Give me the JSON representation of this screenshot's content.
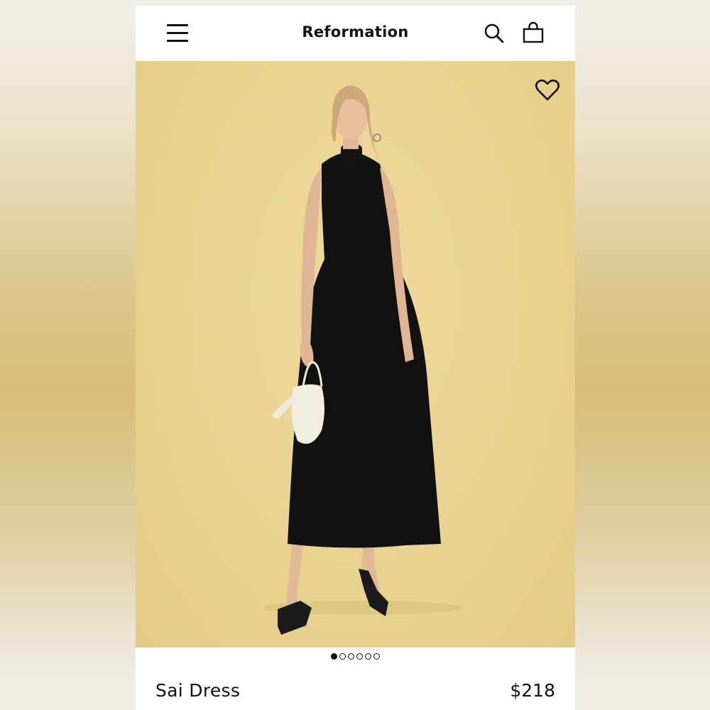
{
  "header": {
    "brand": "Reformation",
    "menu_icon": "hamburger-menu-icon",
    "search_icon": "search-icon",
    "bag_icon": "shopping-bag-icon"
  },
  "hero": {
    "wishlist_icon": "heart-icon",
    "background_color": "#e9d493",
    "image_description_icon": "model-photo"
  },
  "carousel": {
    "total": 6,
    "active_index": 0
  },
  "product": {
    "name": "Sai Dress",
    "price": "$218"
  }
}
